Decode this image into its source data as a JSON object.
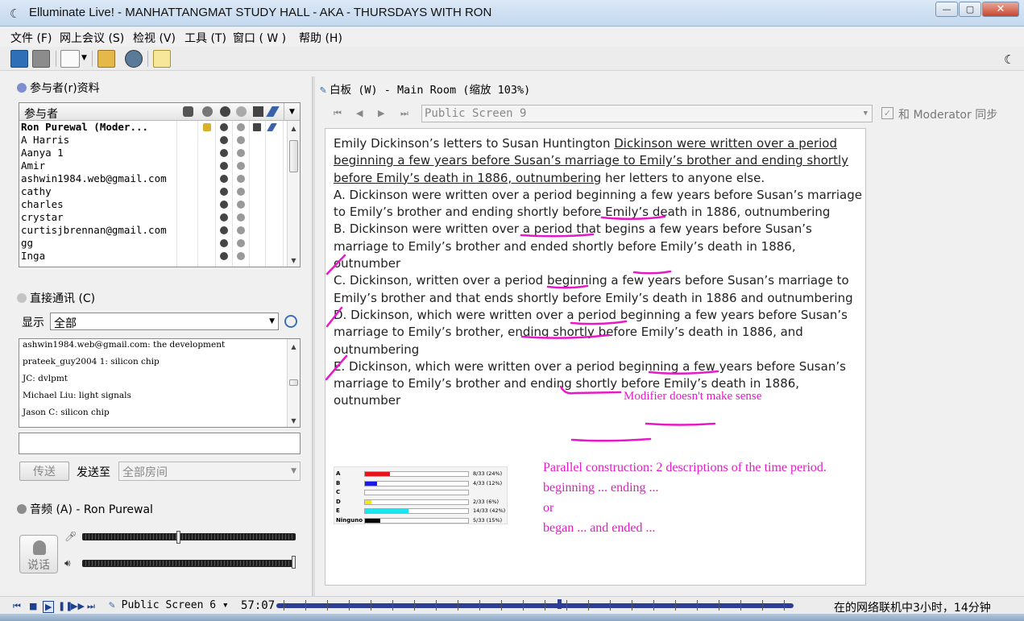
{
  "window": {
    "title": "Elluminate Live! - MANHATTANGMAT STUDY HALL - AKA - THURSDAYS WITH RON"
  },
  "menu": [
    "文件 (F)",
    "网上会议 (S)",
    "检视 (V)",
    "工具 (T)",
    "窗口 ( W )",
    "帮助 (H)"
  ],
  "participants": {
    "title": "参与者(r)资料",
    "header": "参与者",
    "rows": [
      "Ron Purewal (Moder...",
      "A Harris",
      "Aanya 1",
      "Amir",
      "ashwin1984.web@gmail.com",
      "cathy",
      "charles",
      "crystar",
      "curtisjbrennan@gmail.com",
      "gg",
      "Inga"
    ]
  },
  "chat": {
    "title": "直接通讯 (C)",
    "filter_label": "显示",
    "filter_value": "全部",
    "messages": [
      "ashwin1984.web@gmail.com: the development",
      "prateek_guy2004 1: silicon chip",
      "JC: dvlpmt",
      "Michael Liu: light signals",
      "Jason C: silicon chip"
    ],
    "send_label": "传送",
    "send_to_label": "发送至",
    "send_to_value": "全部房间"
  },
  "audio": {
    "title": "音频 (A) - Ron Purewal",
    "talk_label": "说话",
    "mic_level": 0.45,
    "speaker_level": 0.99
  },
  "whiteboard": {
    "title": "白板 (W) - Main Room (缩放 103%)",
    "screen": "Public Screen 9",
    "sync_label": "和 Moderator 同步",
    "question": {
      "stem_pre": "Emily Dickinson’s letters to Susan Huntington ",
      "stem_underlined": "Dickinson were written over a period beginning a few years before Susan’s marriage to Emily’s brother and ending shortly before Emily’s death in 1886, outnumbering",
      "stem_post": " her letters to anyone else.",
      "a": "A. Dickinson were written over a period beginning a few years before Susan’s marriage to Emily’s brother and ending shortly before Emily’s death in 1886, outnumbering",
      "b": "B. Dickinson were written over a period that begins a few years before Susan’s marriage to Emily’s brother and ended shortly before Emily’s death in 1886, outnumber",
      "c": "C. Dickinson, written over a period beginning a few years before Susan’s marriage to Emily’s brother and that ends shortly before Emily’s death in 1886 and outnumbering",
      "d": "D. Dickinson, which were written over a period beginning a few years before Susan’s marriage to Emily’s brother, ending shortly before Emily’s death in 1886, and outnumbering",
      "e": "E. Dickinson, which were written over a period beginning a few years before Susan’s marriage to Emily’s brother and ending shortly before Emily’s death in 1886, outnumber"
    },
    "notes": {
      "modifier": "Modifier doesn't make sense",
      "parallel_1": "Parallel construction: 2 descriptions of the time period.",
      "parallel_2": "beginning ... ending ...",
      "parallel_3": "or",
      "parallel_4": "began ... and ended ..."
    },
    "poll": [
      {
        "label": "A",
        "value": "8/33 (24%)",
        "fraction": 0.24,
        "color": "#e8141b"
      },
      {
        "label": "B",
        "value": "4/33 (12%)",
        "fraction": 0.12,
        "color": "#1a1ae0"
      },
      {
        "label": "C",
        "value": "",
        "fraction": 0,
        "color": "#7a7a7a"
      },
      {
        "label": "D",
        "value": "2/33 (6%)",
        "fraction": 0.06,
        "color": "#f2e616"
      },
      {
        "label": "E",
        "value": "14/33 (42%)",
        "fraction": 0.42,
        "color": "#19e4f0"
      },
      {
        "label": "Ninguno",
        "value": "5/33 (15%)",
        "fraction": 0.15,
        "color": "#050505"
      }
    ]
  },
  "playback": {
    "screen": "Public Screen 6",
    "time": "57:07",
    "online": "在的网络联机中3小时，14分钟"
  },
  "colors": {
    "annotation": "#e619c8",
    "timeline": "#2c3f95"
  }
}
